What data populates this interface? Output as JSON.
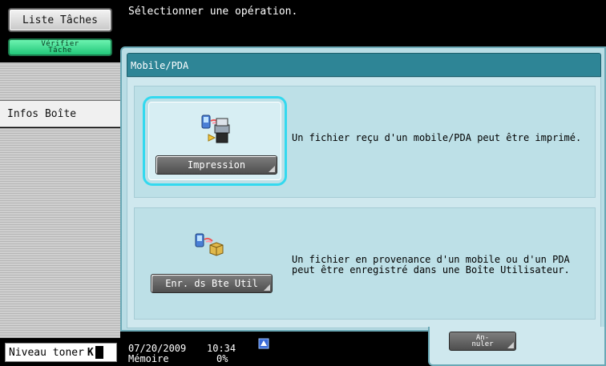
{
  "sidebar": {
    "job_list_label": "Liste Tâches",
    "verify_line1": "Vérifier",
    "verify_line2": "Tâche",
    "box_info_label": "Infos Boîte",
    "toner_label": "Niveau toner",
    "toner_marker": "K"
  },
  "header": {
    "message": "Sélectionner une opération."
  },
  "panel": {
    "title": "Mobile/PDA",
    "options": [
      {
        "button_label": "Impression",
        "description_line1": "Un fichier reçu d'un mobile/PDA peut être imprimé.",
        "description_line2": ""
      },
      {
        "button_label": "Enr. ds Bte Util",
        "description_line1": "Un fichier en provenance d'un mobile ou d'un PDA",
        "description_line2": "peut être enregistré dans une Boîte Utilisateur."
      }
    ]
  },
  "footer": {
    "date": "07/20/2009",
    "time": "10:34",
    "memory_label": "Mémoire",
    "memory_value": "0%",
    "cancel_line1": "An-",
    "cancel_line2": "nuler"
  },
  "colors": {
    "panel_background": "#b9dde5",
    "title_bar": "#2e8596",
    "selection_frame": "#33d9ef",
    "verify_button": "#22c779"
  },
  "icons": {
    "print_option": "mobile-to-printer-icon",
    "save_option": "mobile-to-box-icon",
    "network": "network-icon"
  }
}
